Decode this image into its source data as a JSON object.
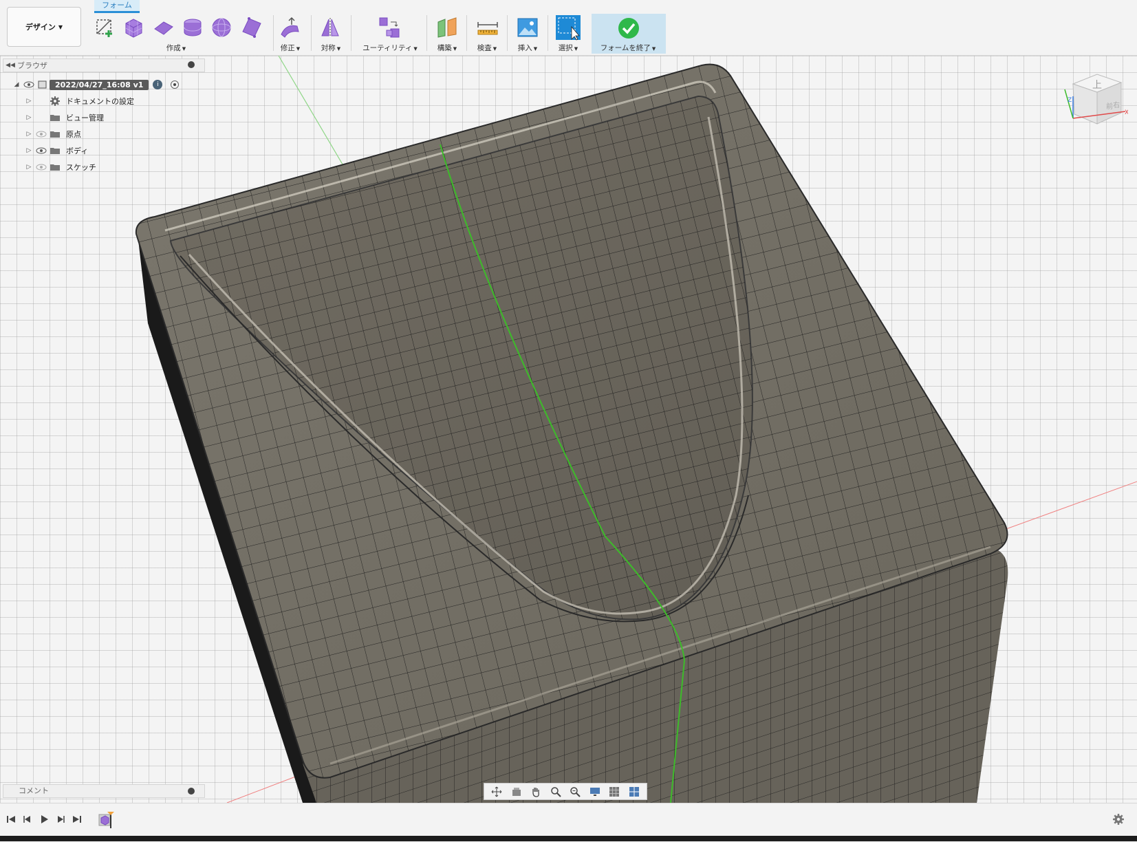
{
  "toolbar": {
    "workspace_label": "デザイン",
    "active_tab": "フォーム",
    "groups": {
      "create": "作成",
      "modify": "修正",
      "symmetry": "対称",
      "utilities": "ユーティリティ",
      "construct": "構築",
      "inspect": "検査",
      "insert": "挿入",
      "select": "選択",
      "finish": "フォームを終了"
    }
  },
  "browser": {
    "title": "ブラウザ",
    "root": "2022/04/27_16:08 v1",
    "items": [
      {
        "label": "ドキュメントの設定",
        "icon": "gear-icon"
      },
      {
        "label": "ビュー管理",
        "icon": "folder-icon"
      },
      {
        "label": "原点",
        "icon": "folder-icon"
      },
      {
        "label": "ボディ",
        "icon": "folder-icon"
      },
      {
        "label": "スケッチ",
        "icon": "folder-icon"
      }
    ]
  },
  "viewcube": {
    "top_label": "上",
    "front_label": "前",
    "right_label": "右",
    "axis_x": "X",
    "axis_z": "Z"
  },
  "comments": {
    "title": "コメント"
  },
  "colors": {
    "accent": "#2a8fd6",
    "form_purple": "#9b6fd6",
    "model_face": "#6f6a60",
    "origin_green": "#3dbb2a",
    "origin_red": "#e04a4a"
  }
}
